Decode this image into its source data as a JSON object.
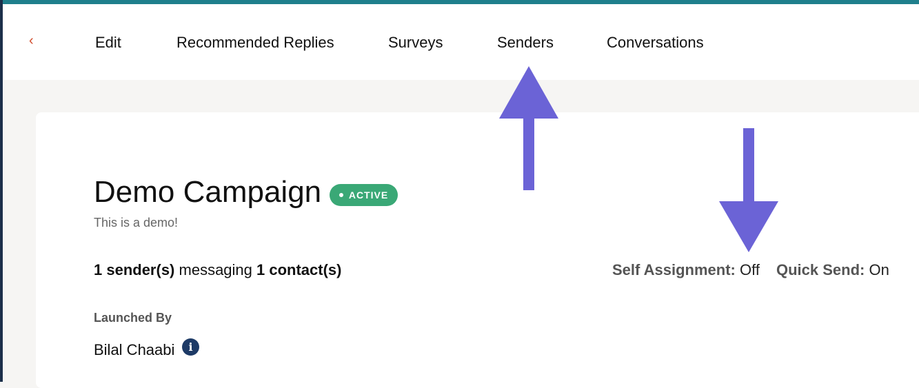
{
  "nav": {
    "back_glyph": "‹",
    "tabs": [
      {
        "label": "Edit"
      },
      {
        "label": "Recommended Replies"
      },
      {
        "label": "Surveys"
      },
      {
        "label": "Senders"
      },
      {
        "label": "Conversations"
      }
    ]
  },
  "campaign": {
    "title": "Demo Campaign",
    "status": "ACTIVE",
    "description": "This is a demo!",
    "senders_count": "1 sender(s)",
    "messaging_text": " messaging ",
    "contacts_count": "1 contact(s)",
    "self_assignment_label": "Self Assignment:",
    "self_assignment_value": "Off",
    "quick_send_label": "Quick Send:",
    "quick_send_value": "On",
    "launched_by_label": "Launched By",
    "launched_by_name": "Bilal Chaabi"
  },
  "icons": {
    "back": "chevron-left-icon",
    "info": "info-icon"
  },
  "colors": {
    "accent": "#d04a2a",
    "status_active": "#3aa876",
    "annotation_arrow": "#6b63d6",
    "info_icon": "#1d3a66",
    "top_strip": "#1f7f8c"
  }
}
